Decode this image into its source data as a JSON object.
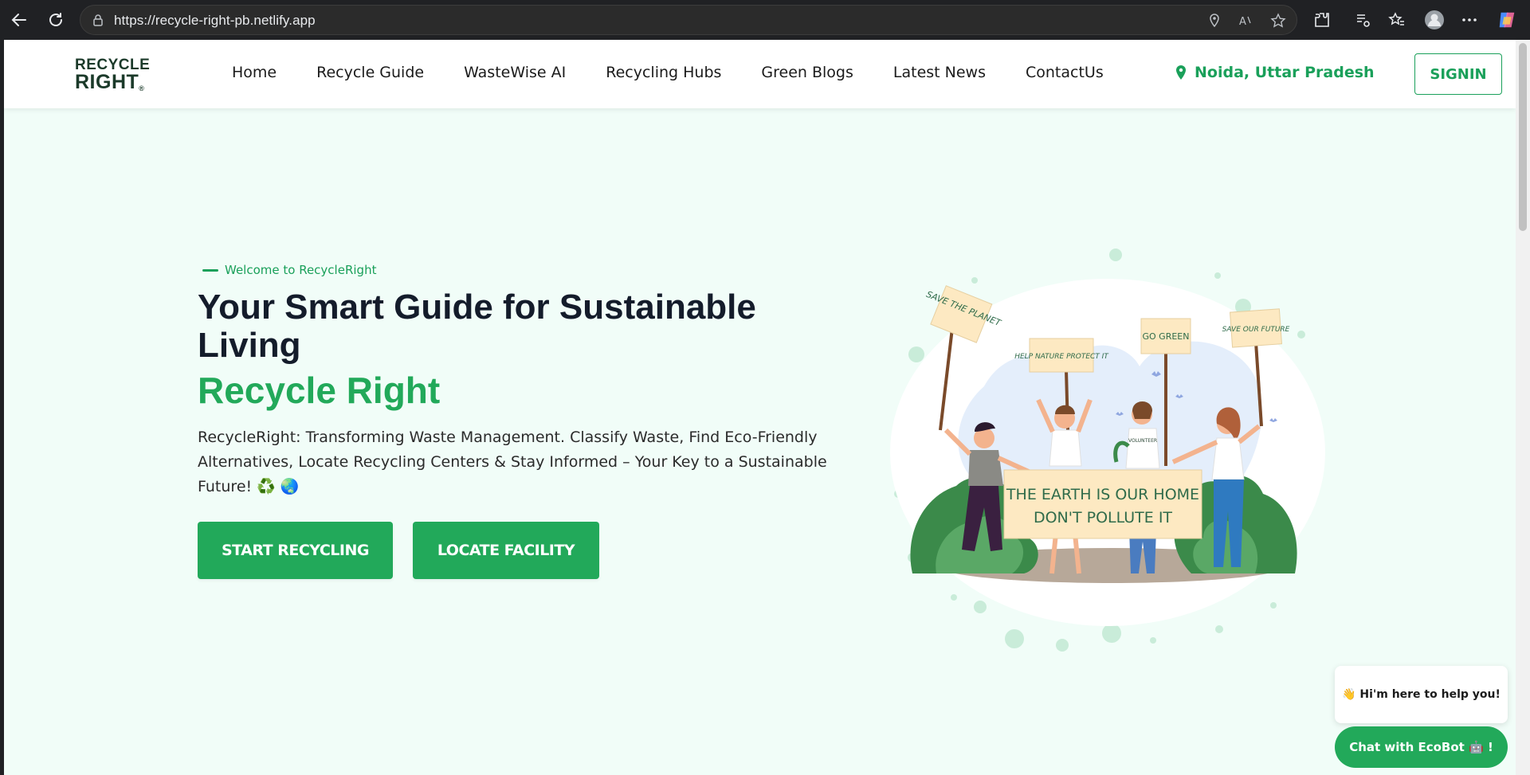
{
  "browser": {
    "url": "https://recycle-right-pb.netlify.app"
  },
  "header": {
    "logo_line1": "RECYCLE",
    "logo_line2": "RIGHT",
    "logo_mark": "®",
    "nav": [
      {
        "label": "Home"
      },
      {
        "label": "Recycle Guide"
      },
      {
        "label": "WasteWise AI"
      },
      {
        "label": "Recycling Hubs"
      },
      {
        "label": "Green Blogs"
      },
      {
        "label": "Latest News"
      },
      {
        "label": "ContactUs"
      }
    ],
    "location": "Noida, Uttar Pradesh",
    "signin_label": "SIGNIN"
  },
  "hero": {
    "welcome": "Welcome to RecycleRight",
    "title": "Your Smart Guide for Sustainable Living",
    "subtitle": "Recycle Right",
    "description": "RecycleRight: Transforming Waste Management. Classify Waste, Find Eco-Friendly Alternatives, Locate Recycling Centers & Stay Informed – Your Key to a Sustainable Future! ♻️ 🌏",
    "primary_button": "START RECYCLING",
    "secondary_button": "LOCATE FACILITY"
  },
  "illustration": {
    "sign_1": "SAVE THE PLANET",
    "sign_2": "HELP NATURE PROTECT IT",
    "sign_3": "GO GREEN",
    "sign_4": "SAVE OUR FUTURE",
    "banner_line1": "THE EARTH IS OUR HOME",
    "banner_line2": "DON'T POLLUTE IT",
    "shirt_text": "VOLUNTEER"
  },
  "chat": {
    "bubble": "👋 Hi'm here to help you!",
    "button": "Chat with EcoBot 🤖 !"
  },
  "colors": {
    "brand_green": "#22a95a",
    "page_bg": "#f1fdf8",
    "title_dark": "#141c2b"
  }
}
